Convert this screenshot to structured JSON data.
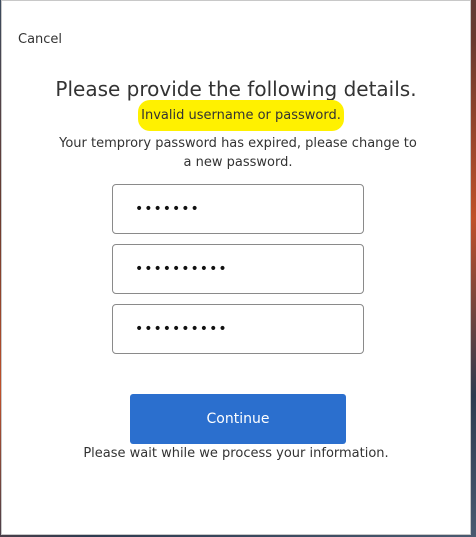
{
  "dialog": {
    "cancel_label": "Cancel",
    "title": "Please provide the following details.",
    "error_message": "Invalid username or password.",
    "info_message": "Your temprory password has expired, please change to a new password.",
    "fields": [
      {
        "masked_value": "•••••••"
      },
      {
        "masked_value": "••••••••••"
      },
      {
        "masked_value": "••••••••••"
      }
    ],
    "continue_label": "Continue",
    "wait_message": "Please wait while we process your information."
  },
  "colors": {
    "error_highlight": "#fff100",
    "primary_button": "#2b6fce"
  }
}
